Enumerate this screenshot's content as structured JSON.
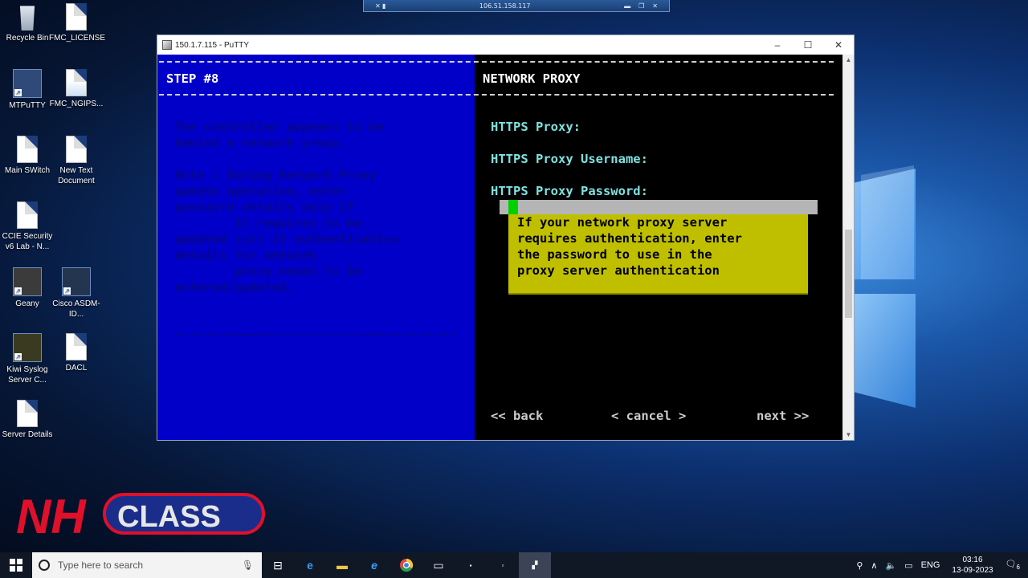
{
  "remote_bar": {
    "ip": "106.51.158.117"
  },
  "desktop_icons": [
    {
      "label": "Recycle Bin"
    },
    {
      "label": "FMC_LICENSE"
    },
    {
      "label": "MTPuTTY"
    },
    {
      "label": "FMC_NGIPS..."
    },
    {
      "label": "Main SWitch"
    },
    {
      "label": "New Text Document"
    },
    {
      "label": "CCIE Security v6 Lab - N..."
    },
    {
      "label": "Geany"
    },
    {
      "label": "Cisco ASDM-ID..."
    },
    {
      "label": "Kiwi Syslog Server C..."
    },
    {
      "label": "DACL"
    },
    {
      "label": "Server Details"
    }
  ],
  "putty": {
    "title": "150.1.7.115 - PuTTY",
    "left": {
      "step": "STEP #8",
      "desc_lines": [
        "The controller appears to be",
        "behind a network proxy."
      ],
      "note_lines": [
        "Note : During Network Proxy",
        "update operation, enter",
        "password details only if",
        "        it requires to be",
        "updated (or) if authentication",
        "details for network",
        "        proxy needs to be",
        "entered/updated."
      ]
    },
    "right": {
      "heading": "NETWORK PROXY",
      "field_proxy": "HTTPS Proxy:",
      "field_username": "HTTPS Proxy Username:",
      "field_password": "HTTPS Proxy Password:",
      "tooltip_lines": [
        "If your network proxy server",
        "requires authentication, enter",
        "the password to use in the",
        "proxy server authentication"
      ],
      "back": "<< back",
      "cancel": "< cancel >",
      "next": "next >>"
    }
  },
  "logo": {
    "nh": "NH",
    "class": "CLASS"
  },
  "taskbar": {
    "search_placeholder": "Type here to search",
    "lang": "ENG",
    "time": "03:16",
    "date": "13-09-2023",
    "notif_count": "6"
  },
  "colors": {
    "left_pane": "#0000c8",
    "tooltip": "#bfbf00",
    "cursor": "#00d000",
    "field_text": "#7fe0e0"
  }
}
